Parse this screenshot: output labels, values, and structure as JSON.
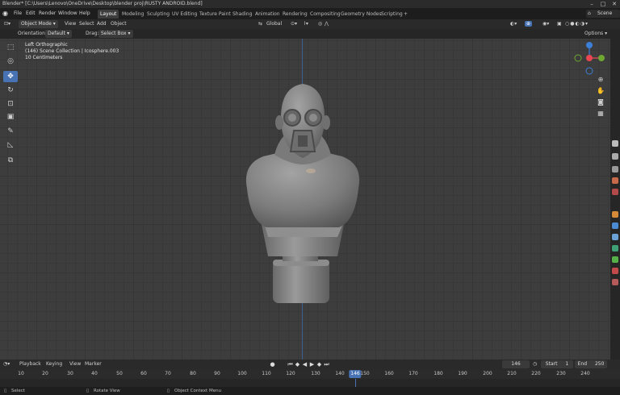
{
  "title_bar": {
    "title": "Blender* [C:\\Users\\Lenovo\\OneDrive\\Desktop\\blender proj\\RUSTY ANDROID.blend]"
  },
  "menu": [
    "File",
    "Edit",
    "Render",
    "Window",
    "Help"
  ],
  "workspaces": [
    "Layout",
    "Modeling",
    "Sculpting",
    "UV Editing",
    "Texture Paint",
    "Shading",
    "Animation",
    "Rendering",
    "Compositing",
    "Geometry Nodes",
    "Scripting"
  ],
  "active_workspace": "Layout",
  "add_workspace": "+",
  "scene": "Scene",
  "viewport_header": {
    "mode": "Object Mode",
    "menus": [
      "View",
      "Select",
      "Add",
      "Object"
    ],
    "transform_orientation": "Global",
    "options": "Options"
  },
  "tool_settings": {
    "orientation_label": "Orientation:",
    "orientation_value": "Default",
    "drag_label": "Drag:",
    "drag_value": "Select Box"
  },
  "viewport_info": {
    "view": "Left Orthographic",
    "collection": "(146) Scene Collection | Icosphere.003",
    "scale": "10 Centimeters"
  },
  "tools": [
    "select-box",
    "cursor",
    "move",
    "rotate",
    "scale",
    "transform",
    "annotate",
    "measure",
    "add-cube"
  ],
  "active_tool": "move",
  "gizmo": {
    "x_color": "#e8474f",
    "y_color": "#6ea832",
    "z_color": "#3c7fd9"
  },
  "timeline": {
    "menus": [
      "Playback",
      "Keying",
      "View",
      "Marker"
    ],
    "current_frame": "146",
    "start_label": "Start",
    "start": "1",
    "end_label": "End",
    "end": "250",
    "ticks": [
      "10",
      "20",
      "30",
      "40",
      "50",
      "60",
      "70",
      "80",
      "90",
      "100",
      "110",
      "120",
      "130",
      "140",
      "150",
      "160",
      "170",
      "180",
      "190",
      "200",
      "210",
      "220",
      "230",
      "240"
    ],
    "playhead": "146"
  },
  "status_bar": [
    "Select",
    "Rotate View",
    "Object Context Menu"
  ],
  "colors": {
    "accent": "#4772b3",
    "viewport_bg": "#3d3d3d"
  }
}
